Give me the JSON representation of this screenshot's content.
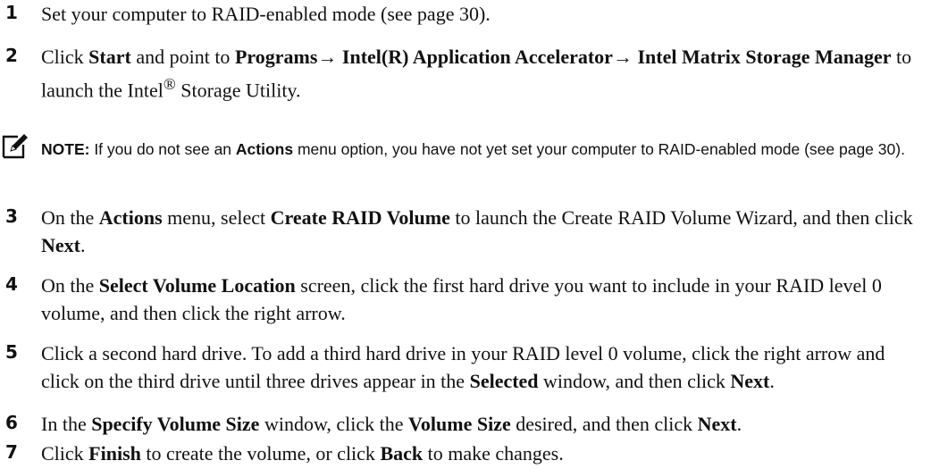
{
  "steps": [
    {
      "number": "1",
      "parts": [
        "Set your computer to RAID-enabled mode (see page 30)."
      ]
    },
    {
      "number": "2",
      "parts": [
        "Click ",
        "Start",
        " and point to ",
        "Programs→ Intel(R) Application Accelerator→ Intel Matrix Storage Manager",
        " to launch the Intel",
        "®",
        " Storage Utility."
      ]
    },
    {
      "number": "3",
      "parts": [
        "On the ",
        "Actions",
        " menu, select ",
        "Create RAID Volume",
        " to launch the Create RAID Volume Wizard, and then click ",
        "Next",
        "."
      ]
    },
    {
      "number": "4",
      "parts": [
        "On the ",
        "Select Volume Location",
        " screen, click the first hard drive you want to include in your RAID level 0 volume, and then click the right arrow."
      ]
    },
    {
      "number": "5",
      "parts": [
        "Click a second hard drive. To add a third hard drive in your RAID level 0 volume, click the right arrow and click on the third drive until three drives appear in the ",
        "Selected",
        " window, and then click ",
        "Next",
        "."
      ]
    },
    {
      "number": "6",
      "parts": [
        "In the ",
        "Specify Volume Size",
        " window, click the ",
        "Volume Size",
        " desired, and then click ",
        "Next",
        "."
      ]
    },
    {
      "number": "7",
      "parts": [
        "Click ",
        "Finish",
        " to create the volume, or click ",
        "Back",
        " to make changes."
      ]
    }
  ],
  "note": {
    "label": "NOTE:",
    "parts": [
      " If you do not see an ",
      "Actions",
      " menu option, you have not yet set your computer to RAID-enabled mode (see page 30)."
    ],
    "icon": "pencil-note-icon"
  }
}
